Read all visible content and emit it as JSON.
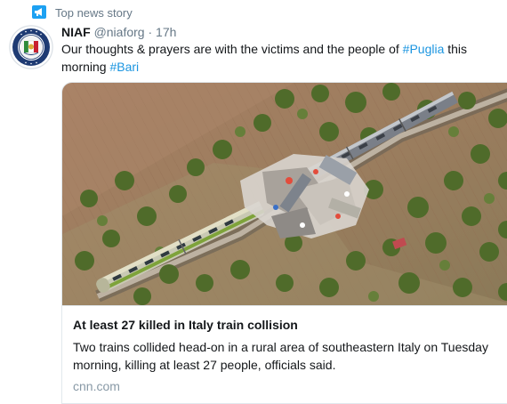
{
  "header_label": {
    "text": "Top news story",
    "icon": "megaphone-icon",
    "color": "#1da1f2"
  },
  "tweet": {
    "author_name": "NIAF",
    "author_handle": "@niaforg",
    "separator": "·",
    "timestamp": "17h",
    "text_before": "Our thoughts & prayers are with the victims and the people of ",
    "hashtag_1": "#Puglia",
    "text_middle": " this morning ",
    "hashtag_2": "#Bari",
    "hashtag_color": "#1b95e0"
  },
  "card": {
    "title": "At least 27 killed in Italy train collision",
    "description": "Two trains collided head-on in a rural area of southeastern Italy on Tuesday morning, killing at least 27 people, officials said.",
    "domain": "cnn.com"
  }
}
